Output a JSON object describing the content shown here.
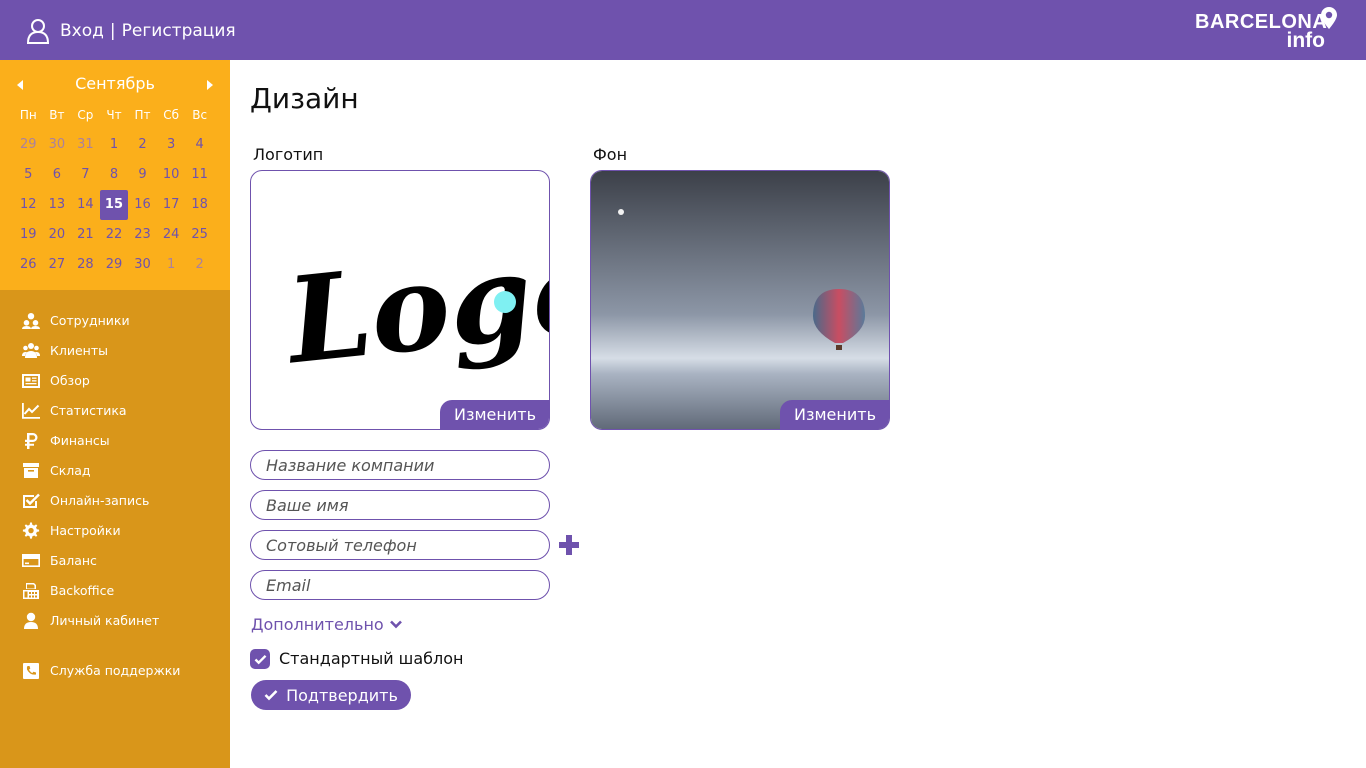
{
  "header": {
    "login_label": "Вход",
    "separator": "|",
    "register_label": "Регистрация",
    "brand_line1": "BARCELONA",
    "brand_line2": "info",
    "bg_color": "#6f52ad"
  },
  "calendar": {
    "month": "Сентябрь",
    "weekdays": [
      "Пн",
      "Вт",
      "Ср",
      "Чт",
      "Пт",
      "Сб",
      "Вс"
    ],
    "selected_day": "15",
    "weeks": [
      [
        "29",
        "30",
        "31",
        "1",
        "2",
        "3",
        "4"
      ],
      [
        "5",
        "6",
        "7",
        "8",
        "9",
        "10",
        "11"
      ],
      [
        "12",
        "13",
        "14",
        "15",
        "16",
        "17",
        "18"
      ],
      [
        "19",
        "20",
        "21",
        "22",
        "23",
        "24",
        "25"
      ],
      [
        "26",
        "27",
        "28",
        "29",
        "30",
        "1",
        "2"
      ]
    ],
    "colors": {
      "calendar_bg": "#fbaf1b",
      "sidebar_bg": "#d9961a",
      "accent": "#6f52ad"
    }
  },
  "sidebar": {
    "items": [
      {
        "label": "Сотрудники",
        "icon": "employees-icon"
      },
      {
        "label": "Клиенты",
        "icon": "clients-icon"
      },
      {
        "label": "Обзор",
        "icon": "overview-icon"
      },
      {
        "label": "Статистика",
        "icon": "statistics-icon"
      },
      {
        "label": "Финансы",
        "icon": "ruble-icon"
      },
      {
        "label": "Склад",
        "icon": "warehouse-icon"
      },
      {
        "label": "Онлайн-запись",
        "icon": "checkbox-icon"
      },
      {
        "label": "Настройки",
        "icon": "gear-icon"
      },
      {
        "label": "Баланс",
        "icon": "credit-card-icon"
      },
      {
        "label": "Backoffice",
        "icon": "fax-icon"
      },
      {
        "label": "Личный кабинет",
        "icon": "user-icon"
      }
    ],
    "support": {
      "label": "Служба поддержки",
      "icon": "phone-icon"
    }
  },
  "main": {
    "title": "Дизайн",
    "logo_label": "Логотип",
    "background_label": "Фон",
    "logo_text": "Logo",
    "change_label": "Изменить",
    "fields": {
      "company_placeholder": "Название компании",
      "name_placeholder": "Ваше имя",
      "phone_placeholder": "Сотовый телефон",
      "email_placeholder": "Email"
    },
    "more_label": "Дополнительно",
    "template_label": "Стандартный шаблон",
    "template_checked": true,
    "submit_label": "Подтвердить"
  }
}
